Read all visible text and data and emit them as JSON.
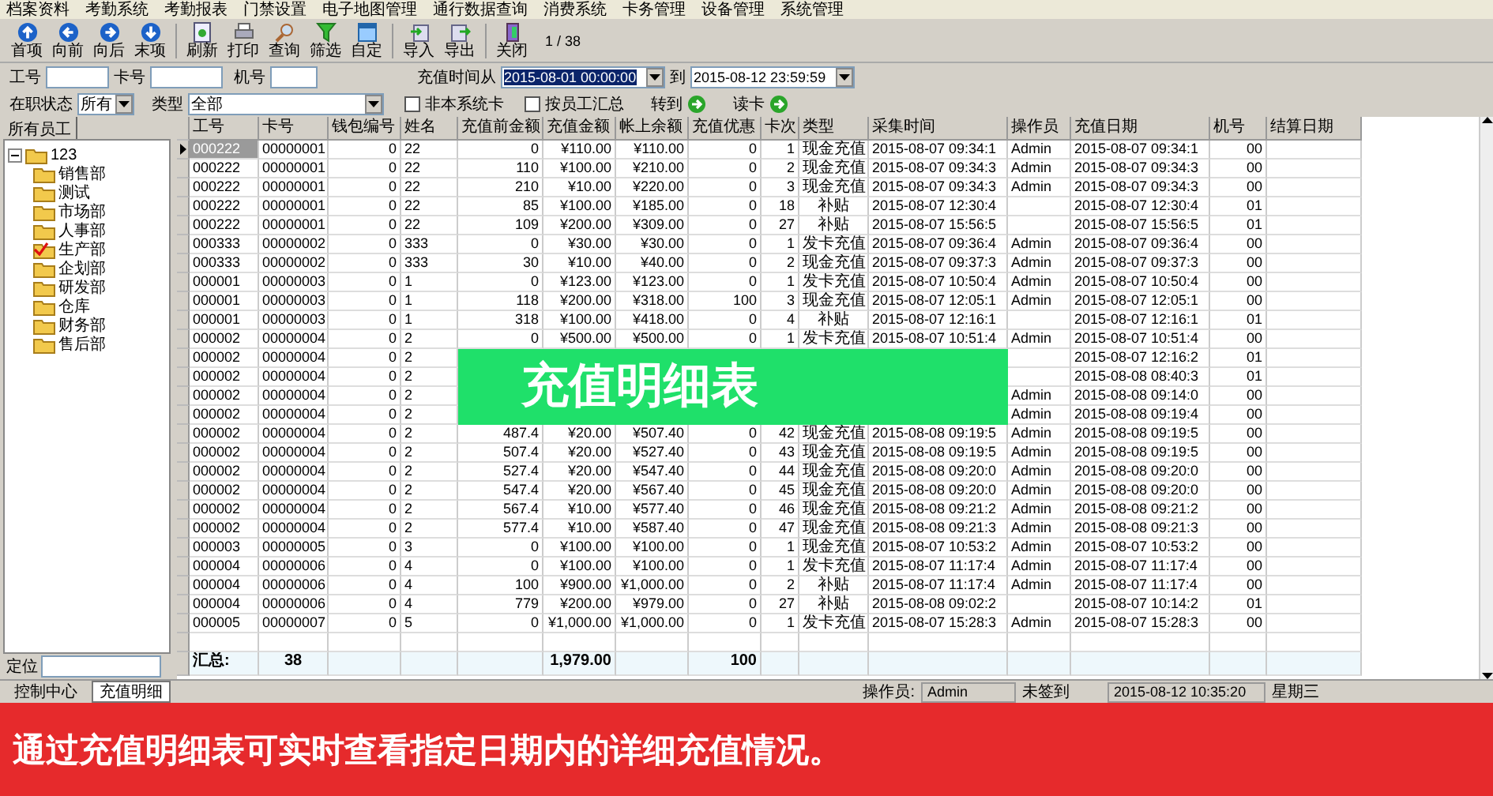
{
  "menu": [
    "档案资料",
    "考勤系统",
    "考勤报表",
    "门禁设置",
    "电子地图管理",
    "通行数据查询",
    "消费系统",
    "卡务管理",
    "设备管理",
    "系统管理"
  ],
  "toolbar": {
    "groups": [
      [
        "首项",
        "向前",
        "向后",
        "末项"
      ],
      [
        "刷新",
        "打印",
        "查询",
        "筛选",
        "自定"
      ],
      [
        "导入",
        "导出"
      ],
      [
        "关闭"
      ]
    ],
    "page": "1 / 38"
  },
  "filters": {
    "employee_id": {
      "label": "工号"
    },
    "card_no": {
      "label": "卡号"
    },
    "machine_no": {
      "label": "机号"
    },
    "date_from": {
      "label": "充值时间从",
      "value": "2015-08-01 00:00:00",
      "text_selected": true
    },
    "date_to": {
      "label": "到",
      "value": "2015-08-12 23:59:59",
      "text_selected": false
    },
    "status": {
      "label": "在职状态",
      "value": "所有"
    },
    "type": {
      "label": "类型",
      "value": "全部"
    },
    "checks": [
      {
        "label": "非本系统卡",
        "checked": false
      },
      {
        "label": "按员工汇总",
        "checked": false
      }
    ],
    "actions": [
      "转到",
      "读卡"
    ]
  },
  "left_panel": {
    "tab": "所有员工",
    "locate_label": "定位",
    "tree": {
      "label": "123",
      "expanded": true,
      "children": [
        {
          "label": "销售部",
          "checked": false
        },
        {
          "label": "测试",
          "checked": false
        },
        {
          "label": "市场部",
          "checked": false
        },
        {
          "label": "人事部",
          "checked": false
        },
        {
          "label": "生产部",
          "checked": true
        },
        {
          "label": "企划部",
          "checked": false
        },
        {
          "label": "研发部",
          "checked": false
        },
        {
          "label": "仓库",
          "checked": false
        },
        {
          "label": "财务部",
          "checked": false
        },
        {
          "label": "售后部",
          "checked": false
        }
      ]
    }
  },
  "table": {
    "columns": [
      "工号",
      "卡号",
      "钱包编号",
      "姓名",
      "充值前金额",
      "充值金额",
      "帐上余额",
      "充值优惠",
      "卡次",
      "类型",
      "采集时间",
      "操作员",
      "充值日期",
      "机号",
      "结算日期"
    ],
    "rows": [
      {
        "selected": true,
        "emp": "000222",
        "card": "00000001",
        "wallet": "0",
        "name": "22",
        "before": "0",
        "amount": "¥110.00",
        "balance": "¥110.00",
        "bonus": "0",
        "times": "1",
        "type": "现金充值",
        "collected": "2015-08-07 09:34:1",
        "operator": "Admin",
        "date": "2015-08-07 09:34:1",
        "machine": "00"
      },
      {
        "selected": false,
        "emp": "000222",
        "card": "00000001",
        "wallet": "0",
        "name": "22",
        "before": "110",
        "amount": "¥100.00",
        "balance": "¥210.00",
        "bonus": "0",
        "times": "2",
        "type": "现金充值",
        "collected": "2015-08-07 09:34:3",
        "operator": "Admin",
        "date": "2015-08-07 09:34:3",
        "machine": "00"
      },
      {
        "selected": false,
        "emp": "000222",
        "card": "00000001",
        "wallet": "0",
        "name": "22",
        "before": "210",
        "amount": "¥10.00",
        "balance": "¥220.00",
        "bonus": "0",
        "times": "3",
        "type": "现金充值",
        "collected": "2015-08-07 09:34:3",
        "operator": "Admin",
        "date": "2015-08-07 09:34:3",
        "machine": "00"
      },
      {
        "selected": false,
        "emp": "000222",
        "card": "00000001",
        "wallet": "0",
        "name": "22",
        "before": "85",
        "amount": "¥100.00",
        "balance": "¥185.00",
        "bonus": "0",
        "times": "18",
        "type": "补贴",
        "collected": "2015-08-07 12:30:4",
        "date": "2015-08-07 12:30:4",
        "machine": "01"
      },
      {
        "selected": false,
        "emp": "000222",
        "card": "00000001",
        "wallet": "0",
        "name": "22",
        "before": "109",
        "amount": "¥200.00",
        "balance": "¥309.00",
        "bonus": "0",
        "times": "27",
        "type": "补贴",
        "collected": "2015-08-07 15:56:5",
        "date": "2015-08-07 15:56:5",
        "machine": "01"
      },
      {
        "selected": false,
        "emp": "000333",
        "card": "00000002",
        "wallet": "0",
        "name": "333",
        "before": "0",
        "amount": "¥30.00",
        "balance": "¥30.00",
        "bonus": "0",
        "times": "1",
        "type": "发卡充值",
        "collected": "2015-08-07 09:36:4",
        "operator": "Admin",
        "date": "2015-08-07 09:36:4",
        "machine": "00"
      },
      {
        "selected": false,
        "emp": "000333",
        "card": "00000002",
        "wallet": "0",
        "name": "333",
        "before": "30",
        "amount": "¥10.00",
        "balance": "¥40.00",
        "bonus": "0",
        "times": "2",
        "type": "现金充值",
        "collected": "2015-08-07 09:37:3",
        "operator": "Admin",
        "date": "2015-08-07 09:37:3",
        "machine": "00"
      },
      {
        "selected": false,
        "emp": "000001",
        "card": "00000003",
        "wallet": "0",
        "name": "1",
        "before": "0",
        "amount": "¥123.00",
        "balance": "¥123.00",
        "bonus": "0",
        "times": "1",
        "type": "发卡充值",
        "collected": "2015-08-07 10:50:4",
        "operator": "Admin",
        "date": "2015-08-07 10:50:4",
        "machine": "00"
      },
      {
        "selected": false,
        "emp": "000001",
        "card": "00000003",
        "wallet": "0",
        "name": "1",
        "before": "118",
        "amount": "¥200.00",
        "balance": "¥318.00",
        "bonus": "100",
        "times": "3",
        "type": "现金充值",
        "collected": "2015-08-07 12:05:1",
        "operator": "Admin",
        "date": "2015-08-07 12:05:1",
        "machine": "00"
      },
      {
        "selected": false,
        "emp": "000001",
        "card": "00000003",
        "wallet": "0",
        "name": "1",
        "before": "318",
        "amount": "¥100.00",
        "balance": "¥418.00",
        "bonus": "0",
        "times": "4",
        "type": "补贴",
        "collected": "2015-08-07 12:16:1",
        "date": "2015-08-07 12:16:1",
        "machine": "01"
      },
      {
        "selected": false,
        "emp": "000002",
        "card": "00000004",
        "wallet": "0",
        "name": "2",
        "before": "0",
        "amount": "¥500.00",
        "balance": "¥500.00",
        "bonus": "0",
        "times": "1",
        "type": "发卡充值",
        "collected": "2015-08-07 10:51:4",
        "operator": "Admin",
        "date": "2015-08-07 10:51:4",
        "machine": "00"
      },
      {
        "selected": false,
        "emp": "000002",
        "card": "00000004",
        "wallet": "0",
        "name": "2",
        "date": "2015-08-07 12:16:2",
        "machine": "01"
      },
      {
        "selected": false,
        "emp": "000002",
        "card": "00000004",
        "wallet": "0",
        "name": "2",
        "date": "2015-08-08 08:40:3",
        "machine": "01"
      },
      {
        "selected": false,
        "emp": "000002",
        "card": "00000004",
        "wallet": "0",
        "name": "2",
        "operator": "Admin",
        "date": "2015-08-08 09:14:0",
        "machine": "00"
      },
      {
        "selected": false,
        "emp": "000002",
        "card": "00000004",
        "wallet": "0",
        "name": "2",
        "operator": "Admin",
        "date": "2015-08-08 09:19:4",
        "machine": "00"
      },
      {
        "selected": false,
        "emp": "000002",
        "card": "00000004",
        "wallet": "0",
        "name": "2",
        "before": "487.4",
        "amount": "¥20.00",
        "balance": "¥507.40",
        "bonus": "0",
        "times": "42",
        "type": "现金充值",
        "collected": "2015-08-08 09:19:5",
        "operator": "Admin",
        "date": "2015-08-08 09:19:5",
        "machine": "00"
      },
      {
        "selected": false,
        "emp": "000002",
        "card": "00000004",
        "wallet": "0",
        "name": "2",
        "before": "507.4",
        "amount": "¥20.00",
        "balance": "¥527.40",
        "bonus": "0",
        "times": "43",
        "type": "现金充值",
        "collected": "2015-08-08 09:19:5",
        "operator": "Admin",
        "date": "2015-08-08 09:19:5",
        "machine": "00"
      },
      {
        "selected": false,
        "emp": "000002",
        "card": "00000004",
        "wallet": "0",
        "name": "2",
        "before": "527.4",
        "amount": "¥20.00",
        "balance": "¥547.40",
        "bonus": "0",
        "times": "44",
        "type": "现金充值",
        "collected": "2015-08-08 09:20:0",
        "operator": "Admin",
        "date": "2015-08-08 09:20:0",
        "machine": "00"
      },
      {
        "selected": false,
        "emp": "000002",
        "card": "00000004",
        "wallet": "0",
        "name": "2",
        "before": "547.4",
        "amount": "¥20.00",
        "balance": "¥567.40",
        "bonus": "0",
        "times": "45",
        "type": "现金充值",
        "collected": "2015-08-08 09:20:0",
        "operator": "Admin",
        "date": "2015-08-08 09:20:0",
        "machine": "00"
      },
      {
        "selected": false,
        "emp": "000002",
        "card": "00000004",
        "wallet": "0",
        "name": "2",
        "before": "567.4",
        "amount": "¥10.00",
        "balance": "¥577.40",
        "bonus": "0",
        "times": "46",
        "type": "现金充值",
        "collected": "2015-08-08 09:21:2",
        "operator": "Admin",
        "date": "2015-08-08 09:21:2",
        "machine": "00"
      },
      {
        "selected": false,
        "emp": "000002",
        "card": "00000004",
        "wallet": "0",
        "name": "2",
        "before": "577.4",
        "amount": "¥10.00",
        "balance": "¥587.40",
        "bonus": "0",
        "times": "47",
        "type": "现金充值",
        "collected": "2015-08-08 09:21:3",
        "operator": "Admin",
        "date": "2015-08-08 09:21:3",
        "machine": "00"
      },
      {
        "selected": false,
        "emp": "000003",
        "card": "00000005",
        "wallet": "0",
        "name": "3",
        "before": "0",
        "amount": "¥100.00",
        "balance": "¥100.00",
        "bonus": "0",
        "times": "1",
        "type": "现金充值",
        "collected": "2015-08-07 10:53:2",
        "operator": "Admin",
        "date": "2015-08-07 10:53:2",
        "machine": "00"
      },
      {
        "selected": false,
        "emp": "000004",
        "card": "00000006",
        "wallet": "0",
        "name": "4",
        "before": "0",
        "amount": "¥100.00",
        "balance": "¥100.00",
        "bonus": "0",
        "times": "1",
        "type": "发卡充值",
        "collected": "2015-08-07 11:17:4",
        "operator": "Admin",
        "date": "2015-08-07 11:17:4",
        "machine": "00"
      },
      {
        "selected": false,
        "emp": "000004",
        "card": "00000006",
        "wallet": "0",
        "name": "4",
        "before": "100",
        "amount": "¥900.00",
        "balance": "¥1,000.00",
        "bonus": "0",
        "times": "2",
        "type": "补贴",
        "collected": "2015-08-07 11:17:4",
        "operator": "Admin",
        "date": "2015-08-07 11:17:4",
        "machine": "00"
      },
      {
        "selected": false,
        "emp": "000004",
        "card": "00000006",
        "wallet": "0",
        "name": "4",
        "before": "779",
        "amount": "¥200.00",
        "balance": "¥979.00",
        "bonus": "0",
        "times": "27",
        "type": "补贴",
        "collected": "2015-08-08 09:02:2",
        "date": "2015-08-07 10:14:2",
        "machine": "01"
      },
      {
        "selected": false,
        "emp": "000005",
        "card": "00000007",
        "wallet": "0",
        "name": "5",
        "before": "0",
        "amount": "¥1,000.00",
        "balance": "¥1,000.00",
        "bonus": "0",
        "times": "1",
        "type": "发卡充值",
        "collected": "2015-08-07 15:28:3",
        "operator": "Admin",
        "date": "2015-08-07 15:28:3",
        "machine": "00"
      }
    ],
    "total": {
      "emp": "汇总:",
      "card": "38",
      "amount": "1,979.00",
      "bonus": "100"
    }
  },
  "banner": "充值明细表",
  "bottom_tabs": [
    {
      "label": "控制中心",
      "selected": false
    },
    {
      "label": "充值明细",
      "selected": true
    }
  ],
  "status_bar": {
    "operator_label": "操作员:",
    "operator": "Admin",
    "sign_status": "未签到",
    "datetime": "2015-08-12 10:35:20",
    "weekday": "星期三"
  },
  "caption": "通过充值明细表可实时查看指定日期内的详细充值情况。"
}
